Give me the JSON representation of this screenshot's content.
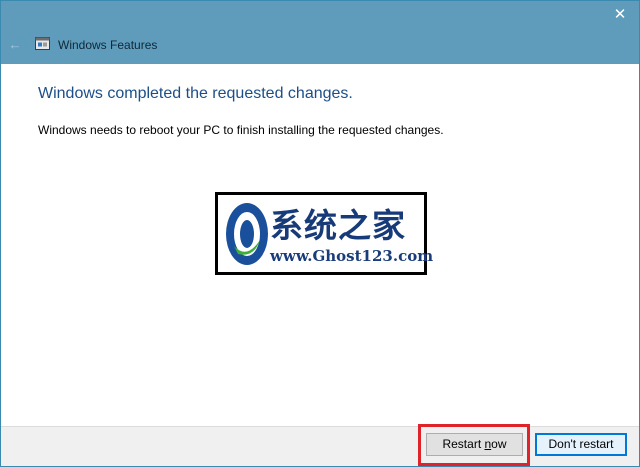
{
  "window": {
    "title": "Windows Features",
    "close_glyph": "✕",
    "back_glyph": "←"
  },
  "content": {
    "heading": "Windows completed the requested changes.",
    "message": "Windows needs to reboot your PC to finish installing the requested changes."
  },
  "watermark": {
    "chinese_text": "系统之家",
    "url_text": "www.Ghost123.com"
  },
  "buttons": {
    "restart_now": {
      "label_prefix": "Restart ",
      "label_underlined": "n",
      "label_suffix": "ow"
    },
    "dont_restart": {
      "label": "Don't restart"
    }
  },
  "colors": {
    "titlebar": "#5f9cbc",
    "heading": "#1d4e89",
    "highlight": "#e0222a",
    "default_button_border": "#0078d7"
  }
}
